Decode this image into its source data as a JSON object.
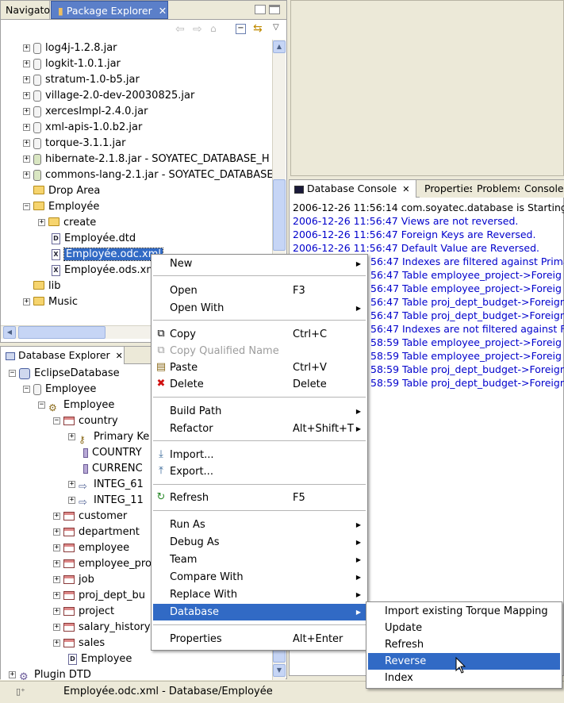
{
  "navigator": {
    "tabs": [
      "Navigator",
      "Package Explorer"
    ],
    "tree": [
      {
        "label": "log4j-1.2.8.jar"
      },
      {
        "label": "logkit-1.0.1.jar"
      },
      {
        "label": "stratum-1.0-b5.jar"
      },
      {
        "label": "village-2.0-dev-20030825.jar"
      },
      {
        "label": "xercesImpl-2.4.0.jar"
      },
      {
        "label": "xml-apis-1.0.b2.jar"
      },
      {
        "label": "torque-3.1.1.jar"
      },
      {
        "label": "hibernate-2.1.8.jar - SOYATEC_DATABASE_H"
      },
      {
        "label": "commons-lang-2.1.jar - SOYATEC_DATABASE"
      },
      {
        "label": "Drop Area"
      },
      {
        "label": "Employée"
      },
      {
        "label": "create"
      },
      {
        "label": "Employée.dtd"
      },
      {
        "label": "Employée.odc.xml"
      },
      {
        "label": "Employée.ods.xml"
      },
      {
        "label": "lib"
      },
      {
        "label": "Music"
      }
    ]
  },
  "db_explorer": {
    "title": "Database Explorer",
    "tree": [
      {
        "label": "EclipseDatabase"
      },
      {
        "label": "Employee"
      },
      {
        "label": "Employee"
      },
      {
        "label": "country"
      },
      {
        "label": "Primary Ke"
      },
      {
        "label": "COUNTRY"
      },
      {
        "label": "CURRENC"
      },
      {
        "label": "INTEG_61"
      },
      {
        "label": "INTEG_11"
      },
      {
        "label": "customer"
      },
      {
        "label": "department"
      },
      {
        "label": "employee"
      },
      {
        "label": "employee_pro"
      },
      {
        "label": "job"
      },
      {
        "label": "proj_dept_bu"
      },
      {
        "label": "project"
      },
      {
        "label": "salary_history"
      },
      {
        "label": "sales"
      },
      {
        "label": "Employee"
      },
      {
        "label": "Plugin DTD"
      }
    ]
  },
  "console": {
    "tabs": [
      "Database Console",
      "Properties",
      "Problems",
      "Console"
    ],
    "lines": [
      {
        "text": "2006-12-26 11:56:14 com.soyatec.database is Starting",
        "color": "#000000"
      },
      {
        "text": "2006-12-26 11:56:47 Views are not reversed.",
        "color": "#0000cc"
      },
      {
        "text": "2006-12-26 11:56:47 Foreign Keys are Reversed.",
        "color": "#0000cc"
      },
      {
        "text": "2006-12-26 11:56:47 Default Value are Reversed.",
        "color": "#0000cc"
      },
      {
        "text": "56:47 Indexes are filtered against Primar",
        "color": "#0000cc"
      },
      {
        "text": "56:47 Table employee_project->Foreig",
        "color": "#0000cc"
      },
      {
        "text": "56:47 Table employee_project->Foreig",
        "color": "#0000cc"
      },
      {
        "text": "56:47 Table proj_dept_budget->Foreign",
        "color": "#0000cc"
      },
      {
        "text": "56:47 Table proj_dept_budget->Foreign",
        "color": "#0000cc"
      },
      {
        "text": "56:47 Indexes are not filtered against Fo",
        "color": "#0000cc"
      },
      {
        "text": "58:59 Table employee_project->Foreig",
        "color": "#0000cc"
      },
      {
        "text": "58:59 Table employee_project->Foreig",
        "color": "#0000cc"
      },
      {
        "text": "58:59 Table proj_dept_budget->Foreign",
        "color": "#0000cc"
      },
      {
        "text": "58:59 Table proj_dept_budget->Foreign",
        "color": "#0000cc"
      }
    ]
  },
  "context_menu": {
    "items": [
      {
        "label": "New",
        "accel": ""
      },
      {
        "label": "Open",
        "accel": "F3"
      },
      {
        "label": "Open With",
        "accel": ""
      },
      {
        "label": "Copy",
        "accel": "Ctrl+C"
      },
      {
        "label": "Copy Qualified Name",
        "accel": ""
      },
      {
        "label": "Paste",
        "accel": "Ctrl+V"
      },
      {
        "label": "Delete",
        "accel": "Delete"
      },
      {
        "label": "Build Path",
        "accel": ""
      },
      {
        "label": "Refactor",
        "accel": "Alt+Shift+T"
      },
      {
        "label": "Import...",
        "accel": ""
      },
      {
        "label": "Export...",
        "accel": ""
      },
      {
        "label": "Refresh",
        "accel": "F5"
      },
      {
        "label": "Run As",
        "accel": ""
      },
      {
        "label": "Debug As",
        "accel": ""
      },
      {
        "label": "Team",
        "accel": ""
      },
      {
        "label": "Compare With",
        "accel": ""
      },
      {
        "label": "Replace With",
        "accel": ""
      },
      {
        "label": "Database",
        "accel": ""
      },
      {
        "label": "Properties",
        "accel": "Alt+Enter"
      }
    ]
  },
  "submenu": {
    "items": [
      "Import existing Torque Mapping",
      "Update",
      "Refresh",
      "Reverse",
      "Index"
    ]
  },
  "status_bar": {
    "text": "Employée.odc.xml - Database/Employée"
  },
  "colors": {
    "selection": "#316ac5",
    "active_tab": "#5b7fc9",
    "console_blue": "#0000cc",
    "chrome": "#ece9d8"
  }
}
